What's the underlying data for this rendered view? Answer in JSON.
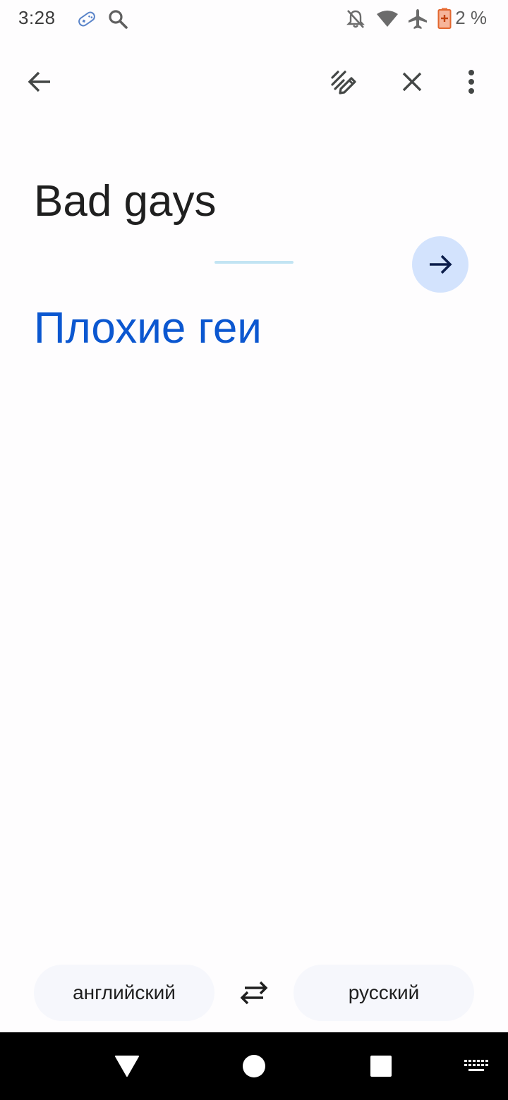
{
  "status_bar": {
    "time": "3:28",
    "battery_percent": "2 %",
    "icons": [
      "game-controller-icon",
      "search-icon",
      "notifications-off-icon",
      "wifi-icon",
      "airplane-icon",
      "battery-low-icon"
    ]
  },
  "app_bar": {
    "icons": [
      "back-arrow-icon",
      "handwriting-icon",
      "close-icon",
      "more-vert-icon"
    ]
  },
  "translation": {
    "source_text": "Bad gays",
    "target_text": "Плохие геи"
  },
  "languages": {
    "source": "английский",
    "target": "русский"
  },
  "colors": {
    "accent": "#0b57d0",
    "go_button_bg": "#d3e3fd",
    "divider": "#c2e4f3",
    "pill_bg": "#f6f7fc"
  },
  "nav_bar": {
    "icons": [
      "nav-back-icon",
      "nav-home-icon",
      "nav-recents-icon",
      "keyboard-icon"
    ]
  }
}
